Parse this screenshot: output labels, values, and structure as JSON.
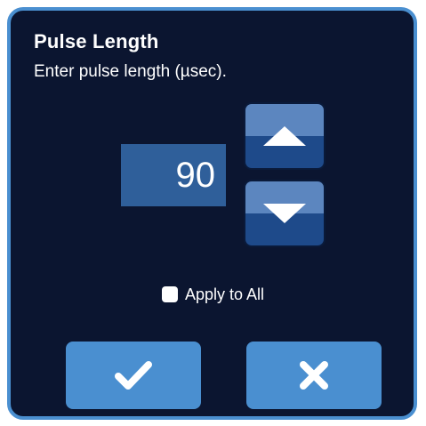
{
  "dialog": {
    "title": "Pulse Length",
    "prompt": "Enter pulse length (µsec).",
    "value": "90",
    "increment_icon": "arrow-up-icon",
    "decrement_icon": "arrow-down-icon",
    "apply_to_all": {
      "label": "Apply to All",
      "checked": false
    },
    "confirm_icon": "checkmark-icon",
    "cancel_icon": "x-icon"
  },
  "colors": {
    "background": "#0b1530",
    "accent": "#4a8fd0",
    "value_box": "#2f5f9a",
    "stepper_top": "#5c86bf",
    "stepper_bottom": "#1e4a8a"
  }
}
